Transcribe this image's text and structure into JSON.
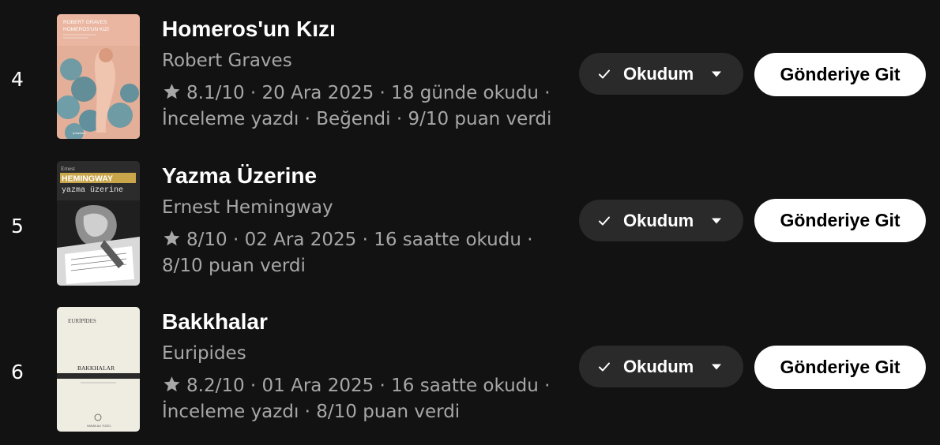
{
  "books": [
    {
      "rank": "4",
      "title": "Homeros'un Kızı",
      "author": "Robert Graves",
      "meta": "8.1/10 · 20 Ara 2025 · 18 günde okudu · İnceleme yazdı · Beğendi · 9/10 puan verdi",
      "status_label": "Okudum",
      "go_label": "Gönderiye Git",
      "cover": {
        "top_text": "ROBERT GRAVES",
        "top_text_2": "HOMEROS'UN KIZI",
        "bg": "#e7b39c",
        "accent": "#4f8fa0"
      }
    },
    {
      "rank": "5",
      "title": "Yazma Üzerine",
      "author": "Ernest Hemingway",
      "meta": "8/10 · 02 Ara 2025 · 16 saatte okudu · 8/10 puan verdi",
      "status_label": "Okudum",
      "go_label": "Gönderiye Git",
      "cover": {
        "top_text": "Ernest",
        "top_text_2": "HEMINGWAY",
        "top_text_3": "yazma üzerine",
        "bg": "#2b2b2b",
        "accent": "#c9a64a"
      }
    },
    {
      "rank": "6",
      "title": "Bakkhalar",
      "author": "Euripides",
      "meta": "8.2/10 · 01 Ara 2025 · 16 saatte okudu · İnceleme yazdı · 8/10 puan verdi",
      "status_label": "Okudum",
      "go_label": "Gönderiye Git",
      "cover": {
        "top_text": "EURİPİDES",
        "top_text_2": "BAKKHALAR",
        "bg": "#f1eee6",
        "accent": "#2a2a2a"
      }
    }
  ],
  "colors": {
    "background": "#121212",
    "secondary_text": "#a7a7a7",
    "status_button_bg": "#2a2a2a",
    "primary_button_bg": "#ffffff"
  },
  "icons": {
    "star": "star-icon",
    "check": "check-icon",
    "caret": "chevron-down-icon"
  }
}
